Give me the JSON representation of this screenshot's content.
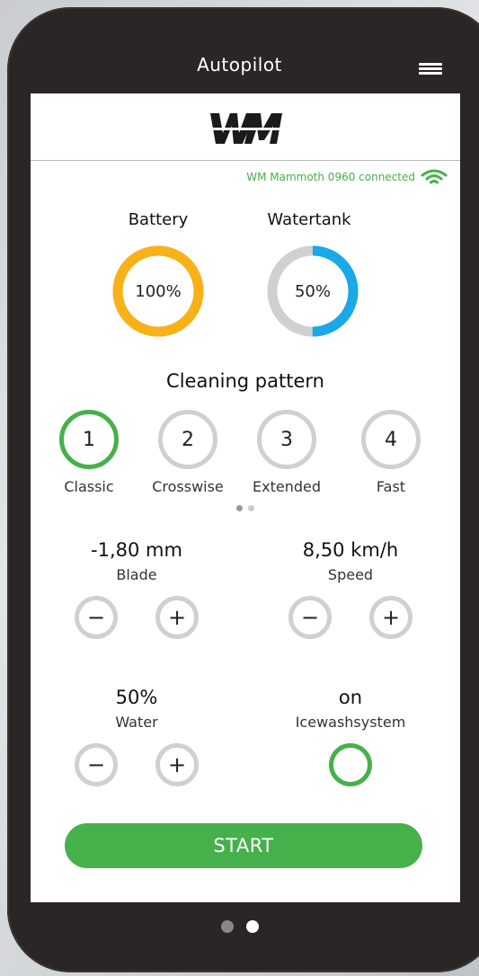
{
  "header": {
    "title": "Autopilot",
    "menu_icon": "hamburger-menu-icon"
  },
  "brand": {
    "logo_text": "WM",
    "accent": "#46b04a"
  },
  "connection": {
    "status_text": "WM Mammoth 0960 connected",
    "icon": "wifi-icon"
  },
  "gauges": {
    "battery": {
      "label": "Battery",
      "value_text": "100%",
      "fraction": 1.0,
      "color": "#f9b118"
    },
    "watertank": {
      "label": "Watertank",
      "value_text": "50%",
      "fraction": 0.5,
      "color": "#19a9e6"
    }
  },
  "cleaning": {
    "title": "Cleaning pattern",
    "patterns": [
      {
        "number": "1",
        "label": "Classic",
        "selected": true
      },
      {
        "number": "2",
        "label": "Crosswise",
        "selected": false
      },
      {
        "number": "3",
        "label": "Extended",
        "selected": false
      },
      {
        "number": "4",
        "label": "Fast",
        "selected": false
      }
    ],
    "page": 1,
    "pages": 2
  },
  "controls": {
    "blade": {
      "value": "-1,80 mm",
      "label": "Blade",
      "minus": "−",
      "plus": "+"
    },
    "speed": {
      "value": "8,50 km/h",
      "label": "Speed",
      "minus": "−",
      "plus": "+"
    },
    "water": {
      "value": "50%",
      "label": "Water",
      "minus": "−",
      "plus": "+"
    },
    "icewash": {
      "value": "on",
      "label": "Icewashsystem"
    }
  },
  "start_button": {
    "label": "START"
  },
  "pager": {
    "current": 2,
    "total": 2
  }
}
